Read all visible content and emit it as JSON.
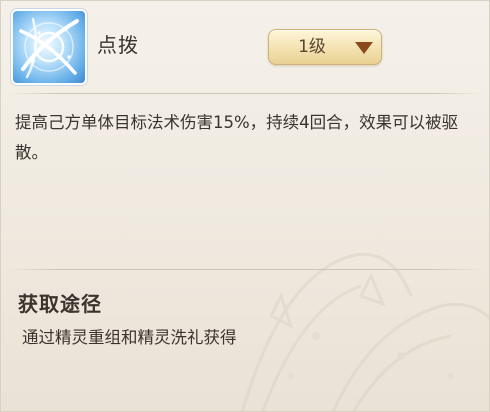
{
  "skill": {
    "icon": "snowflake-swirl-icon",
    "name": "点拨",
    "level": "1级",
    "description": "提高己方单体目标法术伤害15%，持续4回合，效果可以被驱散。"
  },
  "source": {
    "title": "获取途径",
    "text": "通过精灵重组和精灵洗礼获得"
  },
  "colors": {
    "panel_background": "#f2ede4",
    "text": "#3b332e",
    "level_button": "#f3e2b0",
    "level_arrow": "#8a4a1c",
    "icon_blue": "#64aee8"
  }
}
